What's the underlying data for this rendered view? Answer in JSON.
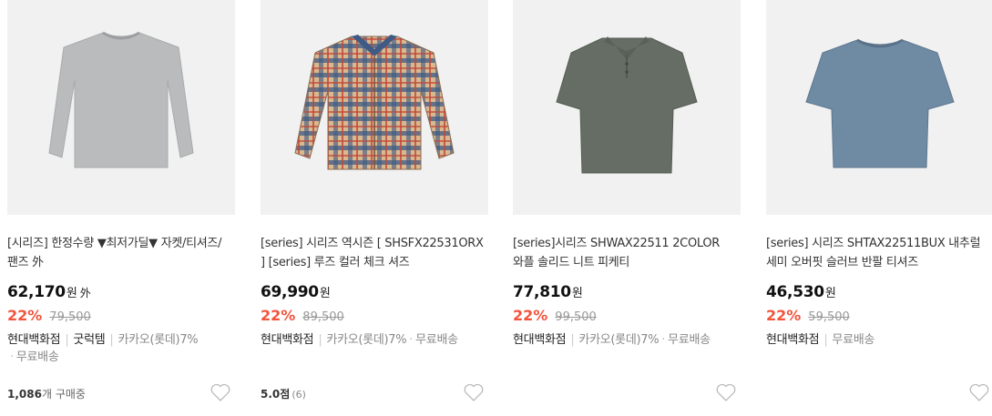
{
  "products": [
    {
      "title": "[시리즈] 한정수량 ▼최저가딜▼ 자켓/티셔즈/팬즈 外",
      "price": "62,170",
      "currency": "원",
      "price_suffix": "外",
      "discount_rate": "22%",
      "original_price": "79,500",
      "seller": "현대백화점",
      "extra_tag": "굿럭템",
      "card_benefit": "카카오(롯데)7%",
      "shipping": "무료배송",
      "sold_count": "1,086",
      "sold_suffix": "개 구매중",
      "product_color": "#b9bbbc",
      "product_icon": "sweater-icon"
    },
    {
      "title": "[series] 시리즈 역시즌 [ SHSFX22531ORX ] [series] 루즈 컬러 체크 셔즈",
      "price": "69,990",
      "currency": "원",
      "discount_rate": "22%",
      "original_price": "89,500",
      "seller": "현대백화점",
      "card_benefit": "카카오(롯데)7%",
      "shipping": "무료배송",
      "rating": "5.0점",
      "review_count": "(6)",
      "product_color": "#c98a5a",
      "product_icon": "plaid-shirt-icon"
    },
    {
      "title": "[series]시리즈 SHWAX22511 2COLOR 와플 솔리드 니트 피케티",
      "price": "77,810",
      "currency": "원",
      "discount_rate": "22%",
      "original_price": "99,500",
      "seller": "현대백화점",
      "card_benefit": "카카오(롯데)7%",
      "shipping": "무료배송",
      "product_color": "#656d64",
      "product_icon": "polo-shirt-icon"
    },
    {
      "title": "[series] 시리즈 SHTAX22511BUX 내추럴 세미 오버핏 슬러브 반팔 티셔즈",
      "price": "46,530",
      "currency": "원",
      "discount_rate": "22%",
      "original_price": "59,500",
      "seller": "현대백화점",
      "shipping": "무료배송",
      "product_color": "#6f8aa3",
      "product_icon": "tshirt-icon"
    }
  ],
  "colors": {
    "discount": "#f2543c",
    "thumb_bg": "#f1f1f1"
  }
}
